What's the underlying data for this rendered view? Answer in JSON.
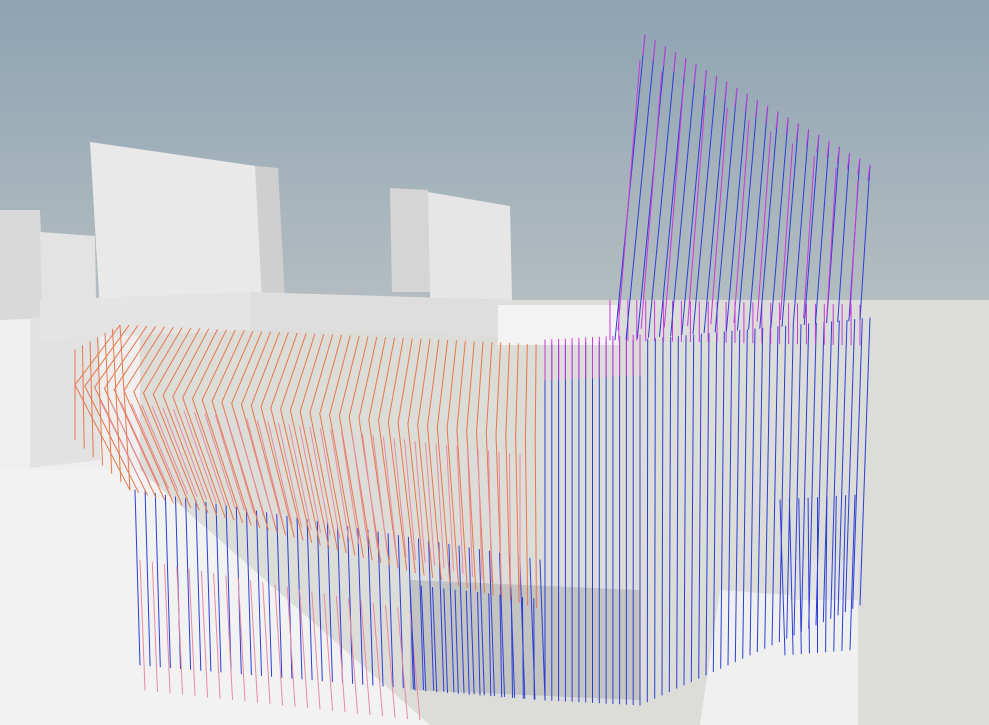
{
  "scene": {
    "sky_top": "#8ea3b4",
    "sky_horizon": "#d8d4c6",
    "ground": "#f1f1f1",
    "building_light": "#eeeeee",
    "building_mid": "#d9d9d9",
    "building_shadow": "#bdbdbd",
    "rebar_orange": "#e8784a",
    "rebar_pink": "#e88aa0",
    "rebar_blue": "#2a3fd6",
    "rebar_magenta": "#c63bd9"
  }
}
